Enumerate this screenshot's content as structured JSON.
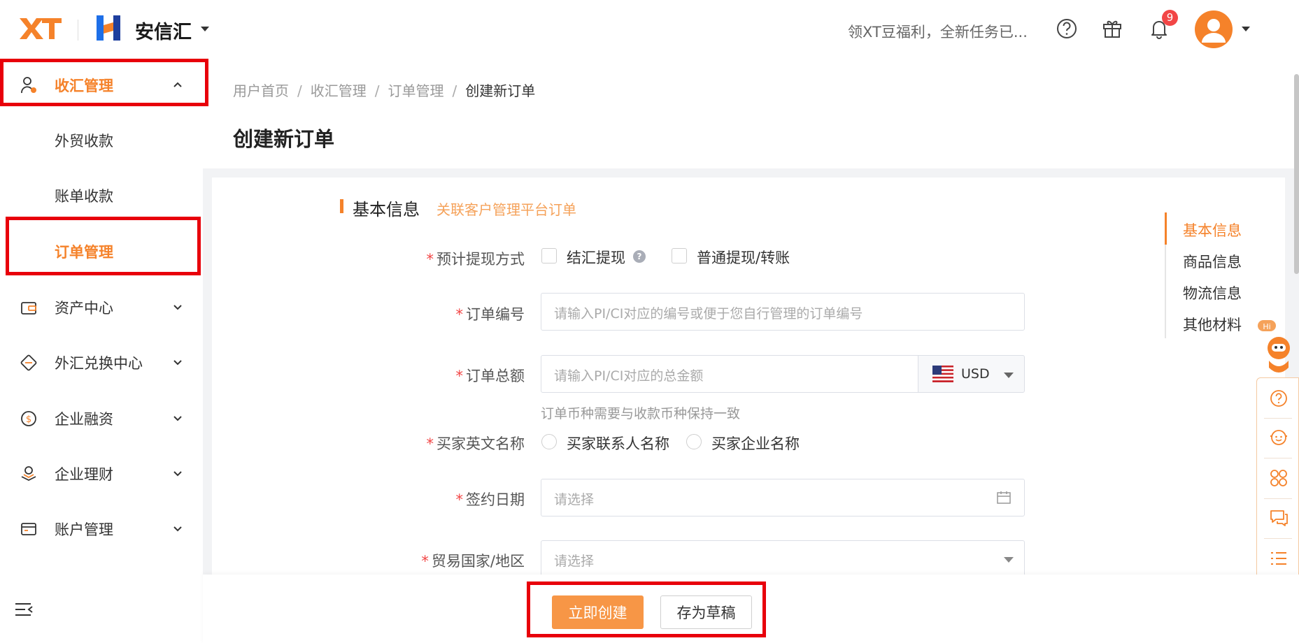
{
  "header": {
    "logo_text": "XT",
    "brand_name": "安信汇",
    "promo_text": "领XT豆福利，全新任务已...",
    "notification_count": "9",
    "colors": {
      "accent": "#f5822a",
      "badge": "#f24646",
      "brand_blue": "#1e6fe8"
    },
    "icons": [
      "help-icon",
      "gift-icon",
      "bell-icon",
      "avatar",
      "chevron-down-icon"
    ]
  },
  "sidebar": {
    "items": [
      {
        "label": "收汇管理",
        "icon": "user-money-icon",
        "expanded": true,
        "active": true
      },
      {
        "label": "外贸收款",
        "sub": true
      },
      {
        "label": "账单收款",
        "sub": true
      },
      {
        "label": "订单管理",
        "sub": true,
        "active": true
      },
      {
        "label": "资产中心",
        "icon": "wallet-icon"
      },
      {
        "label": "外汇兑换中心",
        "icon": "exchange-icon"
      },
      {
        "label": "企业融资",
        "icon": "dollar-cycle-icon"
      },
      {
        "label": "企业理财",
        "icon": "finance-icon"
      },
      {
        "label": "账户管理",
        "icon": "card-icon"
      }
    ]
  },
  "breadcrumb": {
    "items": [
      "用户首页",
      "收汇管理",
      "订单管理"
    ],
    "current": "创建新订单",
    "separator": "/"
  },
  "page_title": "创建新订单",
  "form": {
    "section_title": "基本信息",
    "section_link": "关联客户管理平台订单",
    "withdraw": {
      "label": "预计提现方式",
      "options": [
        "结汇提现",
        "普通提现/转账"
      ]
    },
    "order_no": {
      "label": "订单编号",
      "placeholder": "请输入PI/CI对应的编号或便于您自行管理的订单编号"
    },
    "order_amount": {
      "label": "订单总额",
      "placeholder": "请输入PI/CI对应的总金额",
      "currency": "USD",
      "hint": "订单币种需要与收款币种保持一致"
    },
    "buyer_name": {
      "label": "买家英文名称",
      "options": [
        "买家联系人名称",
        "买家企业名称"
      ]
    },
    "sign_date": {
      "label": "签约日期",
      "placeholder": "请选择"
    },
    "trade_country": {
      "label": "贸易国家/地区",
      "placeholder": "请选择"
    },
    "required_mark": "*"
  },
  "anchors": [
    "基本信息",
    "商品信息",
    "物流信息",
    "其他材料"
  ],
  "float_toolbar": {
    "robot_badge": "Hi",
    "icons": [
      "help-icon",
      "service-face-icon",
      "apps-icon",
      "chat-icon",
      "list-icon"
    ]
  },
  "footer": {
    "create_label": "立即创建",
    "draft_label": "存为草稿"
  }
}
